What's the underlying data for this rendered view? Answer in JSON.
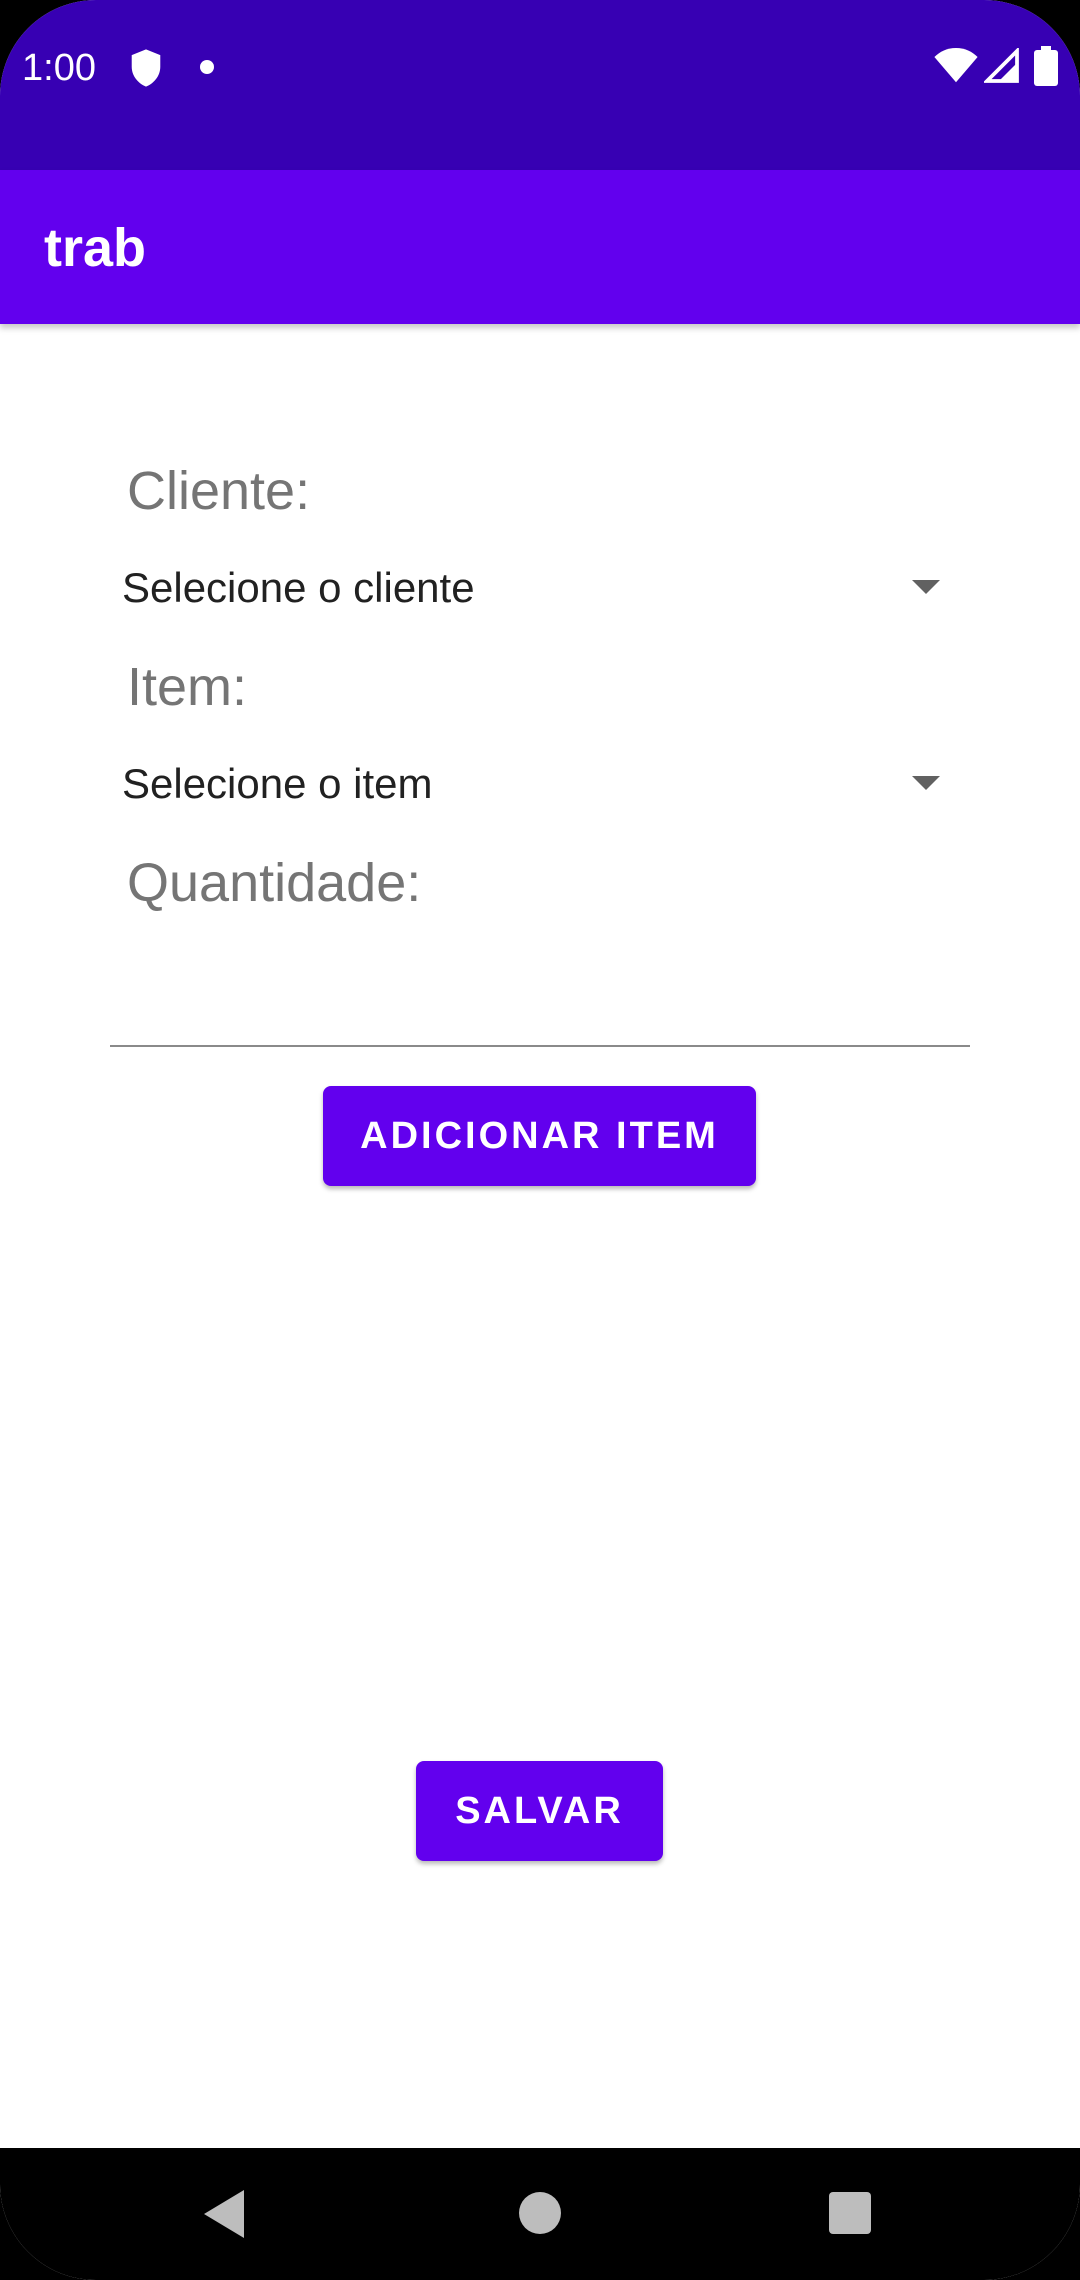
{
  "status_bar": {
    "time": "1:00",
    "icons": [
      "shield-icon",
      "notification-dot-icon",
      "wifi-icon",
      "cellular-signal-icon",
      "battery-icon"
    ]
  },
  "app_bar": {
    "title": "trab"
  },
  "form": {
    "cliente_label": "Cliente:",
    "cliente_spinner_value": "Selecione o cliente",
    "item_label": "Item:",
    "item_spinner_value": "Selecione o item",
    "quantidade_label": "Quantidade:",
    "quantidade_value": "",
    "add_item_button": "ADICIONAR ITEM",
    "save_button": "SALVAR"
  },
  "nav_bar": {
    "icons": [
      "back-icon",
      "home-icon",
      "recents-icon"
    ]
  },
  "colors": {
    "status_bar": "#3700B3",
    "primary": "#6200EE",
    "label_text": "#757575",
    "body_text": "#212121"
  }
}
